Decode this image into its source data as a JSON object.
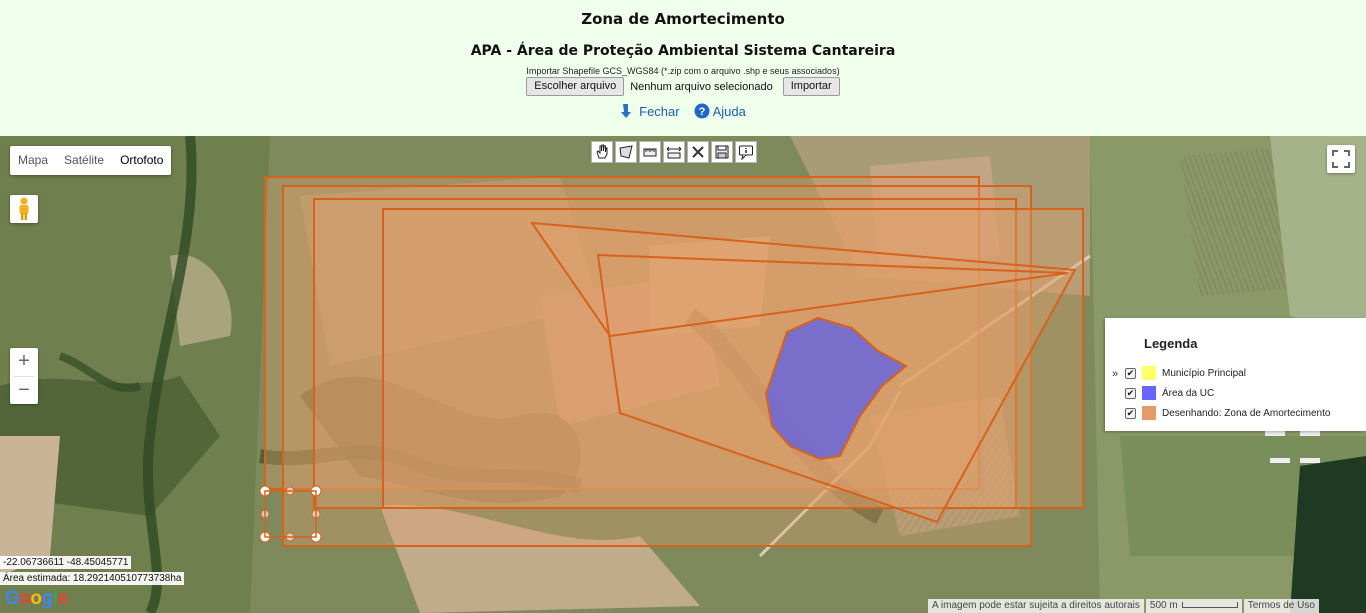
{
  "header": {
    "title": "Zona de Amortecimento",
    "subtitle": "APA - Área de Proteção Ambiental Sistema Cantareira",
    "import_hint": "Importar Shapefile GCS_WGS84 (*.zip com o arquivo .shp e seus associados)",
    "choose_file_label": "Escolher arquivo",
    "no_file_text": "Nenhum arquivo selecionado",
    "import_label": "Importar",
    "close_label": "Fechar",
    "help_label": "Ajuda"
  },
  "map": {
    "type_buttons": [
      "Mapa",
      "Satélite",
      "Ortofoto"
    ],
    "active_type": "Ortofoto",
    "zoom_in": "+",
    "zoom_out": "−",
    "toolbar_icons": [
      "hand-pan-icon",
      "draw-polygon-icon",
      "measure-area-icon",
      "measure-distance-icon",
      "delete-icon",
      "save-icon",
      "info-icon"
    ],
    "coordinates": "-22.06736611 -48.45045771",
    "area_estimate": "Área estimada: 18.292140510773738ha",
    "google_logo": "Google",
    "attribution": "A imagem pode estar sujeita a direitos autorais",
    "scale_label": "500 m",
    "terms_label": "Termos de Uso"
  },
  "legend": {
    "title": "Legenda",
    "collapse_icon": "»",
    "items": [
      {
        "label": "Município Principal",
        "color": "#ffff66",
        "checked": true
      },
      {
        "label": "Área da UC",
        "color": "#6666ff",
        "checked": true
      },
      {
        "label": "Desenhando: Zona de Amortecimento",
        "color": "#e59a6a",
        "checked": true
      }
    ]
  },
  "colors": {
    "header_bg": "#efffec",
    "drawing_stroke": "#e06c1a",
    "uc_fill": "#5f63e8",
    "link_blue": "#1d5fb0"
  }
}
